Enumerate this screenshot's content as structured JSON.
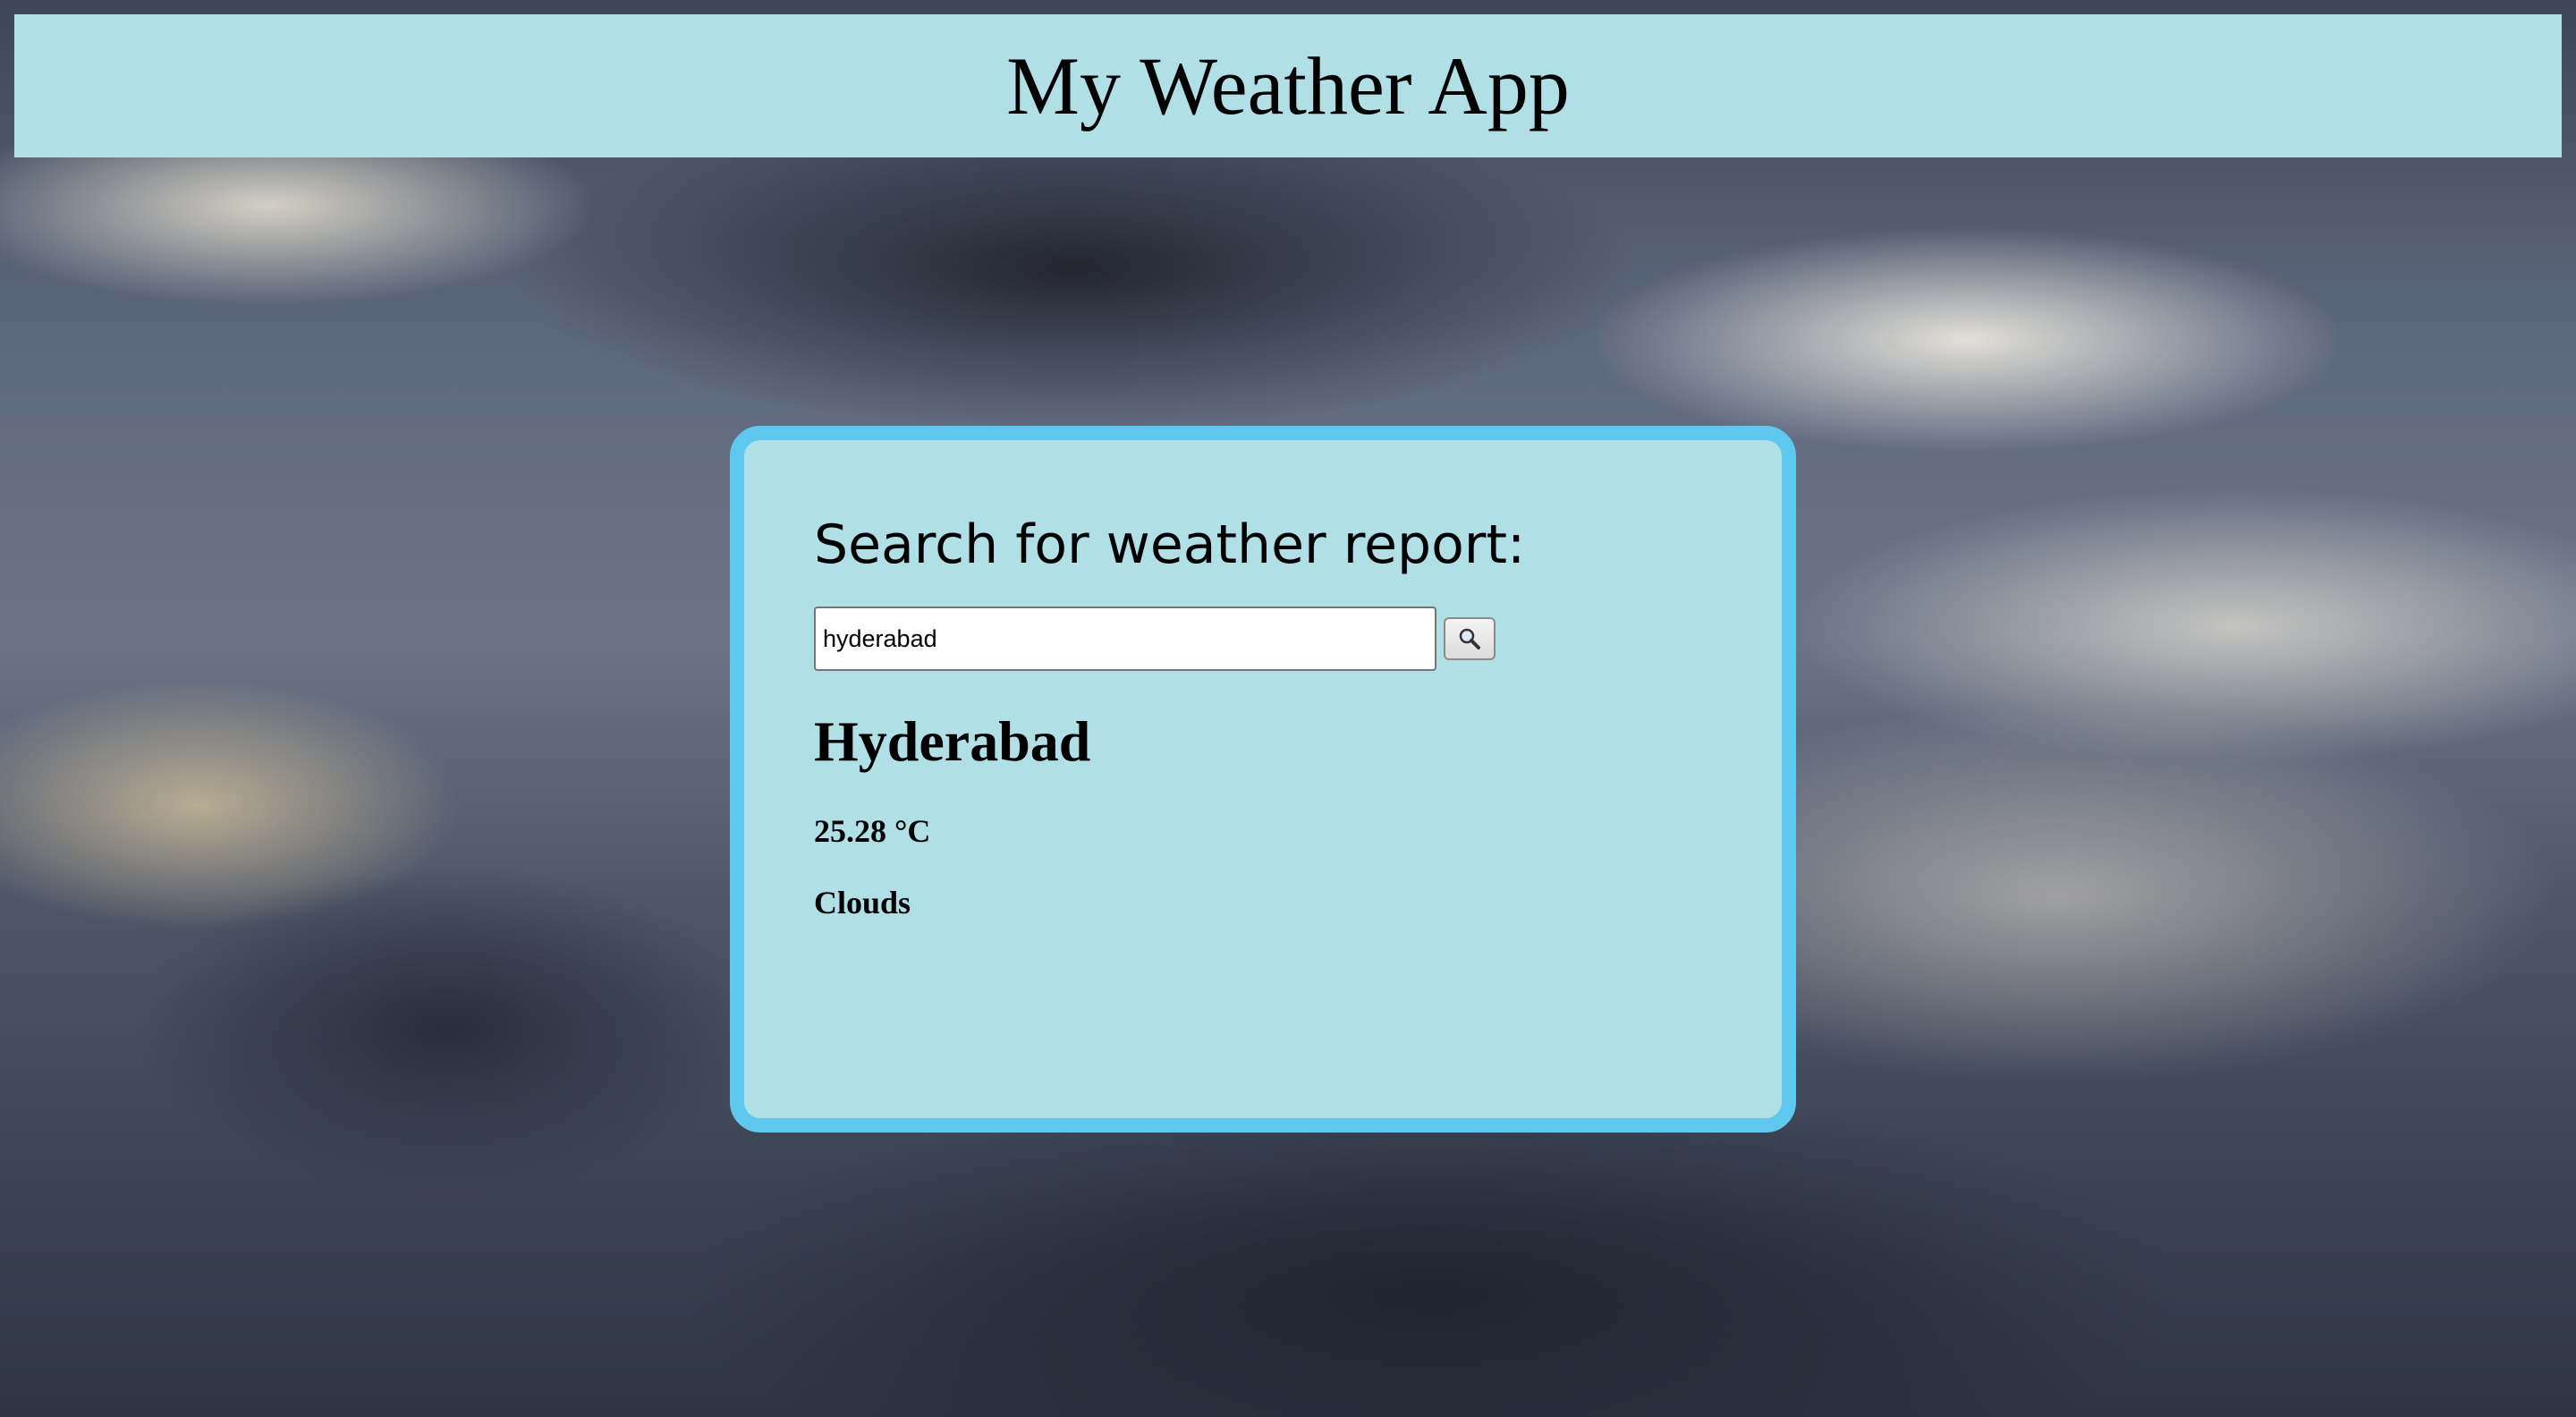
{
  "header": {
    "title": "My Weather App"
  },
  "search": {
    "prompt": "Search for weather report:",
    "input_value": "hyderabad",
    "button_icon": "search-icon"
  },
  "weather": {
    "city": "Hyderabad",
    "temperature": "25.28 °C",
    "description": "Clouds"
  },
  "colors": {
    "panel_background": "#b0dfe6",
    "card_border": "#5ec8ee"
  }
}
